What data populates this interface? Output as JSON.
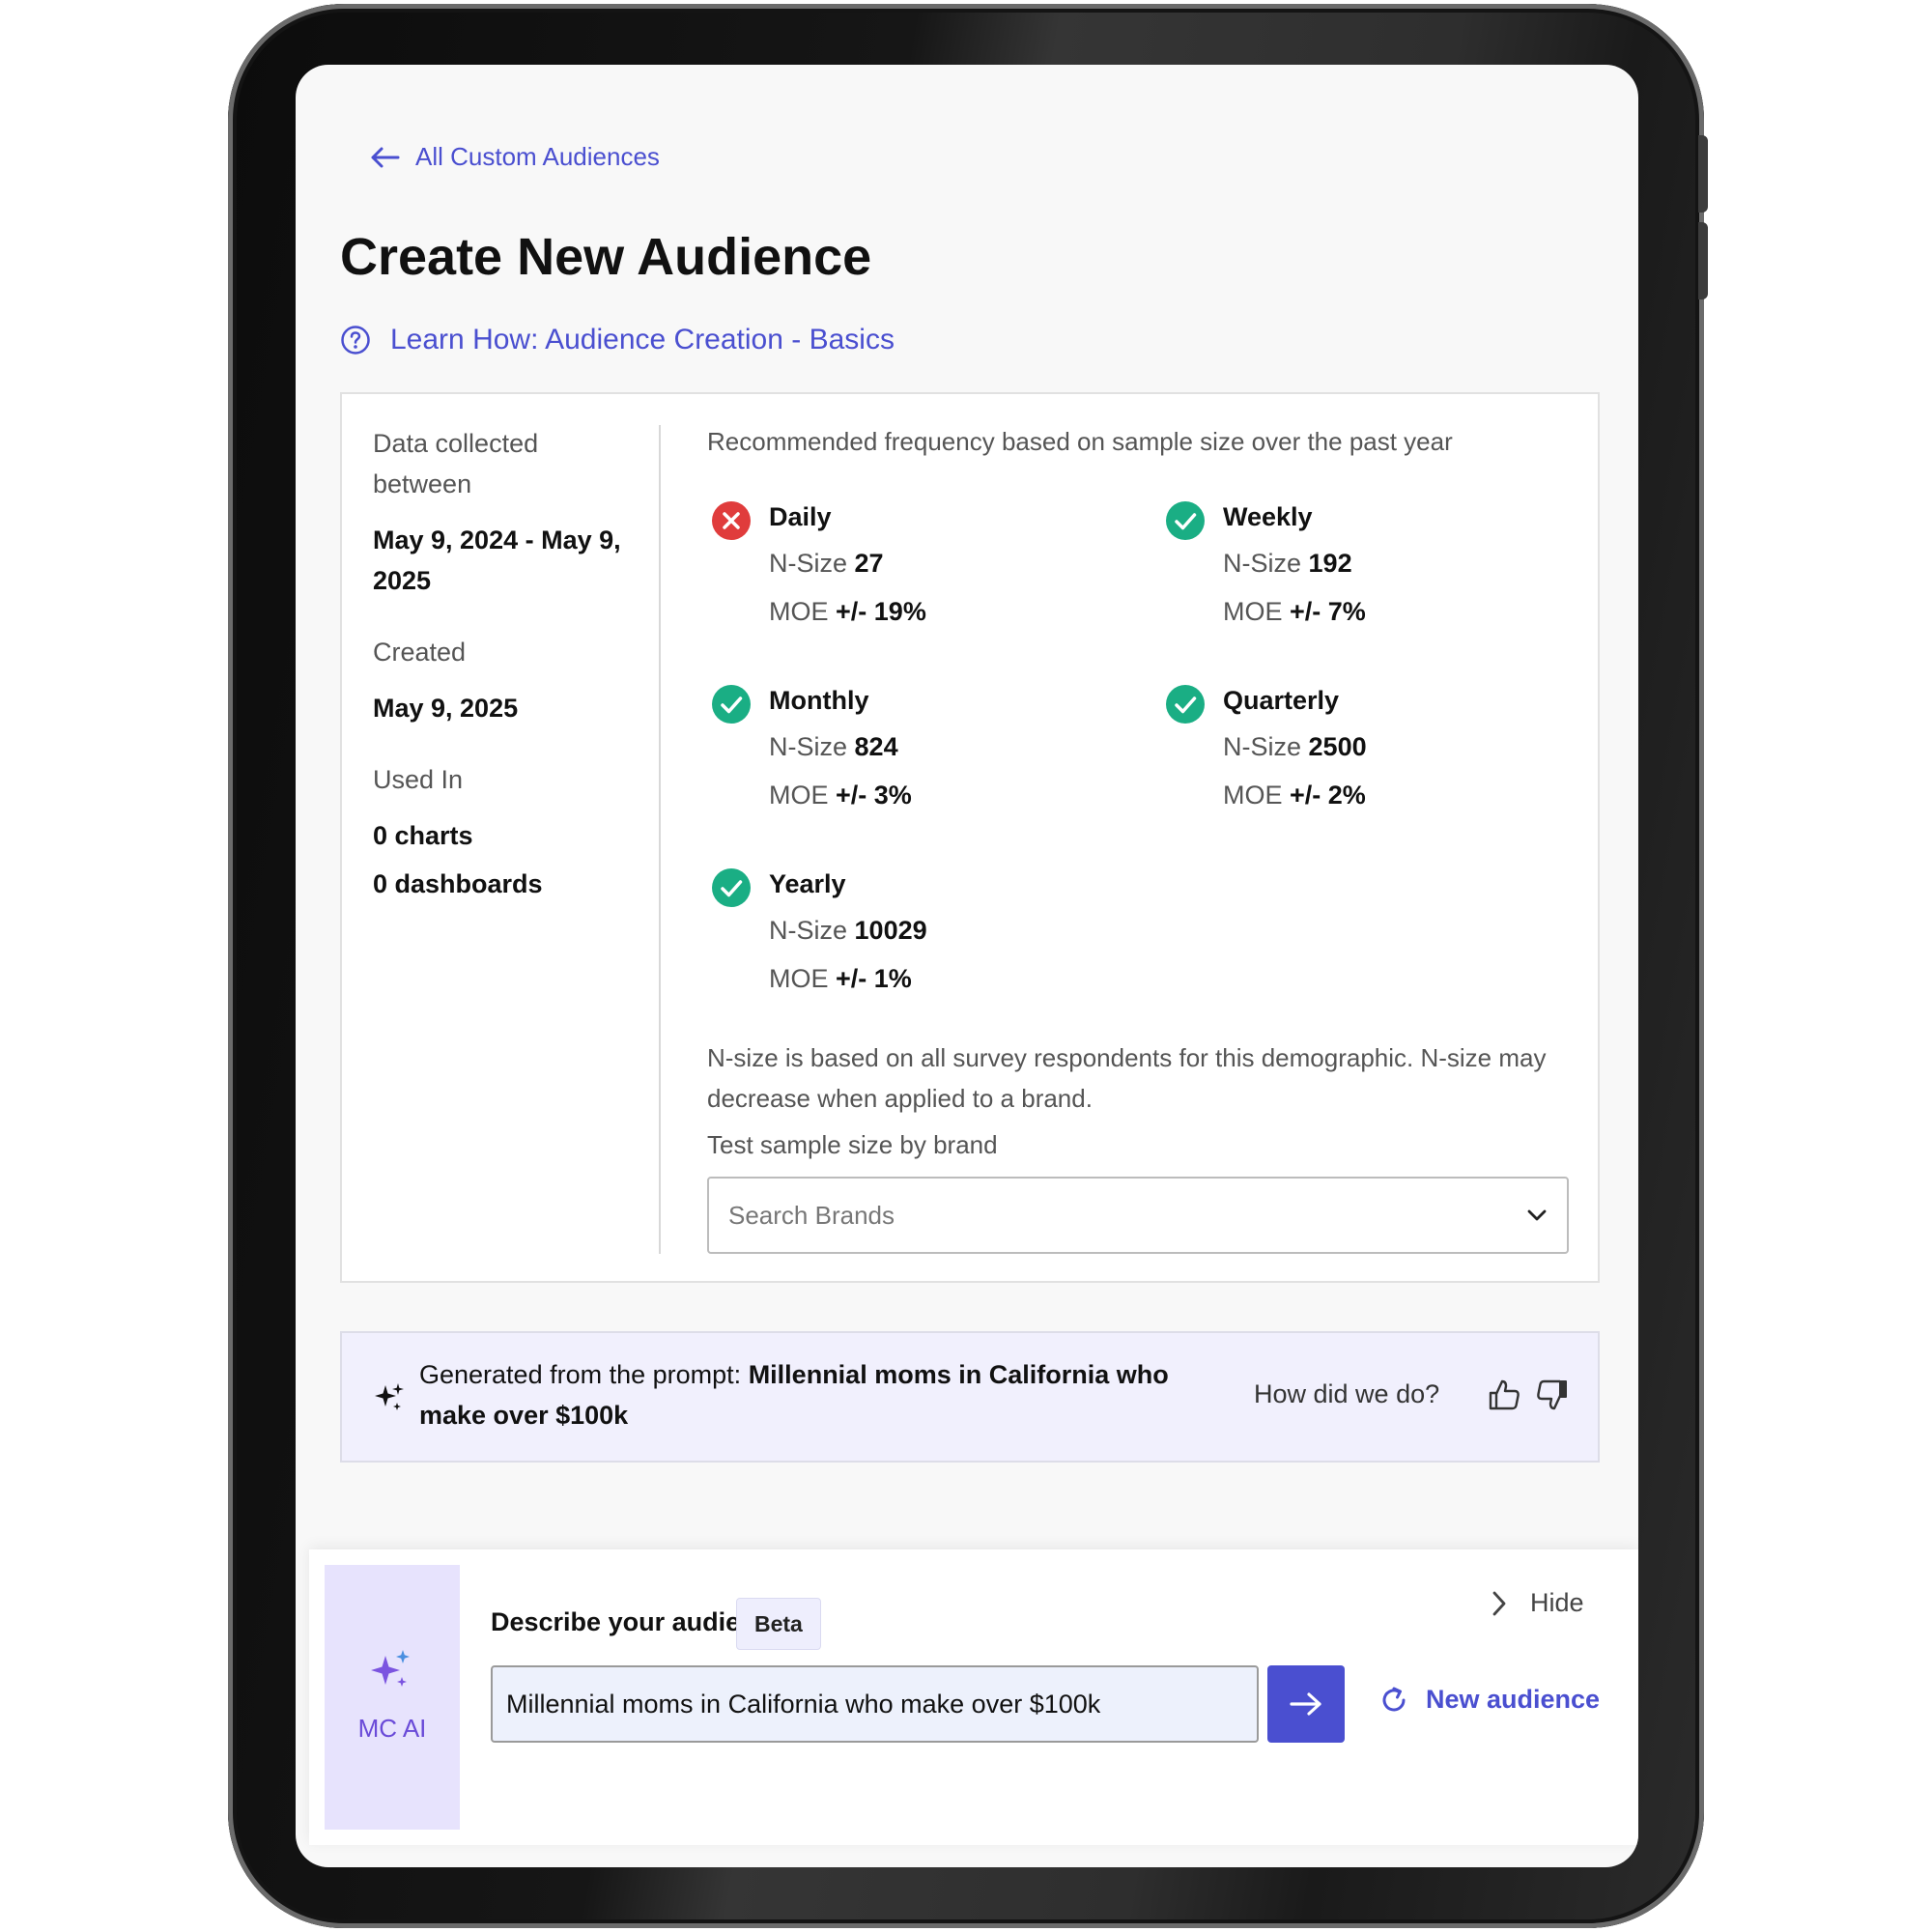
{
  "header": {
    "back_link_label": "All Custom Audiences",
    "page_title": "Create New Audience",
    "learn_link_label": "Learn How: Audience Creation - Basics"
  },
  "meta": {
    "data_collected_label": "Data collected between",
    "data_collected_value": "May 9, 2024 - May 9, 2025",
    "created_label": "Created",
    "created_value": "May 9, 2025",
    "used_in_label": "Used In",
    "charts_value": "0 charts",
    "dashboards_value": "0 dashboards"
  },
  "recommendation": {
    "title": "Recommended frequency based on sample size over the past year",
    "n_size_label": "N-Size",
    "moe_label": "MOE",
    "frequencies": [
      {
        "name": "Daily",
        "n_size": "27",
        "moe": "+/- 19%",
        "status": "not-recommended"
      },
      {
        "name": "Weekly",
        "n_size": "192",
        "moe": "+/- 7%",
        "status": "recommended"
      },
      {
        "name": "Monthly",
        "n_size": "824",
        "moe": "+/- 3%",
        "status": "recommended"
      },
      {
        "name": "Quarterly",
        "n_size": "2500",
        "moe": "+/- 2%",
        "status": "recommended"
      },
      {
        "name": "Yearly",
        "n_size": "10029",
        "moe": "+/- 1%",
        "status": "recommended"
      }
    ],
    "note": "N-size is based on all survey respondents for this demographic. N-size may decrease when applied to a brand.",
    "test_label": "Test sample size by brand",
    "search_placeholder": "Search Brands"
  },
  "prompt_banner": {
    "prefix": "Generated from the prompt:",
    "prompt": "Millennial moms in California who make over $100k",
    "feedback_label": "How did we do?"
  },
  "ai_panel": {
    "brand_label": "MC AI",
    "describe_label": "Describe your audience",
    "beta_label": "Beta",
    "hide_label": "Hide",
    "input_value": "Millennial moms in California who make over $100k",
    "new_audience_label": "New audience"
  },
  "colors": {
    "accent": "#4a4fd0",
    "success": "#1aae84",
    "error": "#e03c3c",
    "ai_purple": "#6a4bd8"
  }
}
